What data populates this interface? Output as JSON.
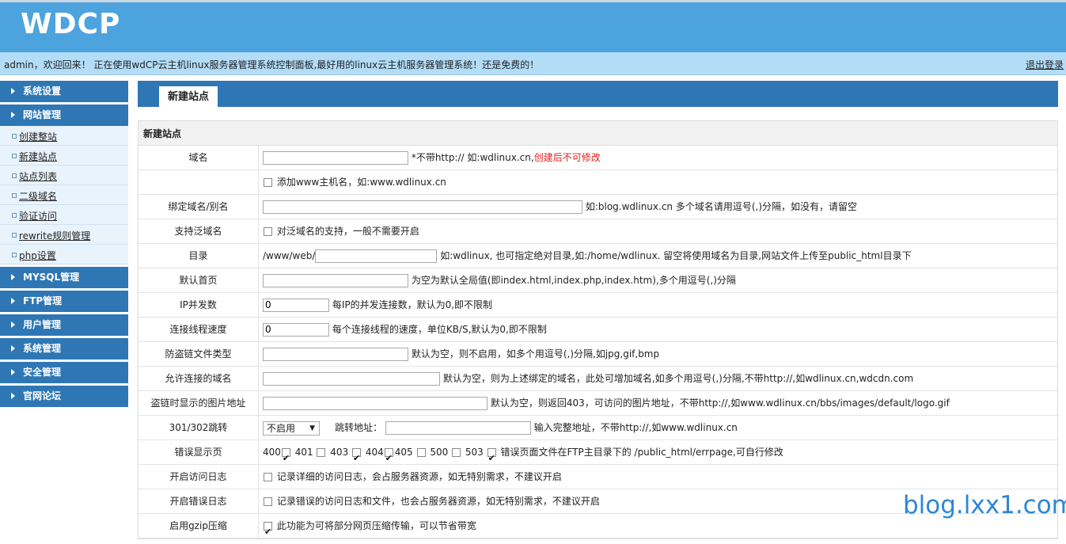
{
  "brand": {
    "logo": "WDCP"
  },
  "welcome": {
    "message": "admin，欢迎回来！ 正在使用wdCP云主机linux服务器管理系统控制面板,最好用的linux云主机服务器管理系统！还是免费的！",
    "logout": "退出登录"
  },
  "sidebar": {
    "sections": [
      {
        "label": "系统设置"
      },
      {
        "label": "网站管理",
        "items": [
          "创建整站",
          "新建站点",
          "站点列表",
          "二级域名",
          "验证访问",
          "rewrite规则管理",
          "php设置"
        ]
      },
      {
        "label": "MYSQL管理"
      },
      {
        "label": "FTP管理"
      },
      {
        "label": "用户管理"
      },
      {
        "label": "系统管理"
      },
      {
        "label": "安全管理"
      },
      {
        "label": "官网论坛"
      }
    ]
  },
  "main": {
    "tab": "新建站点",
    "form_title": "新建站点",
    "rows": {
      "domain": {
        "label": "域名",
        "hint": "*不带http:// 如:wdlinux.cn,",
        "hint_red": "创建后不可修改",
        "value": ""
      },
      "www": {
        "hint": "添加www主机名，如:www.wdlinux.cn"
      },
      "alias": {
        "label": "绑定域名/别名",
        "hint": "如:blog.wdlinux.cn 多个域名请用逗号(,)分隔，如没有，请留空"
      },
      "wildcard": {
        "label": "支持泛域名",
        "hint": "对泛域名的支持，一般不需要开启"
      },
      "dir": {
        "label": "目录",
        "prefix": "/www/web/",
        "hint": "如:wdlinux, 也可指定绝对目录,如:/home/wdlinux. 留空将使用域名为目录,网站文件上传至public_html目录下"
      },
      "index": {
        "label": "默认首页",
        "hint": "为空为默认全局值(即index.html,index.php,index.htm),多个用逗号(,)分隔"
      },
      "ipconn": {
        "label": "IP并发数",
        "value": "0",
        "hint": "每IP的并发连接数，默认为0,即不限制"
      },
      "speed": {
        "label": "连接线程速度",
        "value": "0",
        "hint": "每个连接线程的速度，单位KB/S,默认为0,即不限制"
      },
      "hotlink": {
        "label": "防盗链文件类型",
        "hint": "默认为空，则不启用，如多个用逗号(,)分隔,如jpg,gif,bmp"
      },
      "allowed": {
        "label": "允许连接的域名",
        "hint": "默认为空，则为上述绑定的域名，此处可增加域名,如多个用逗号(,)分隔,不带http://,如wdlinux.cn,wdcdn.com"
      },
      "hotimg": {
        "label": "盗链时显示的图片地址",
        "hint": "默认为空，则返回403，可访问的图片地址，不带http://,如www.wdlinux.cn/bbs/images/default/logo.gif"
      },
      "redirect": {
        "label": "301/302跳转",
        "select": "不启用",
        "target_label": "跳转地址：",
        "hint": "输入完整地址，不带http://,如www.wdlinux.cn"
      },
      "errpage": {
        "label": "错误显示页",
        "codes": [
          {
            "code": "400",
            "checked": true
          },
          {
            "code": "401",
            "checked": false
          },
          {
            "code": "403",
            "checked": true
          },
          {
            "code": "404",
            "checked": true
          },
          {
            "code": "405",
            "checked": false
          },
          {
            "code": "500",
            "checked": false
          },
          {
            "code": "503",
            "checked": true
          }
        ],
        "hint": "错误页面文件在FTP主目录下的 /public_html/errpage,可自行修改"
      },
      "accesslog": {
        "label": "开启访问日志",
        "hint": "记录详细的访问日志，会占服务器资源，如无特别需求，不建议开启"
      },
      "errorlog": {
        "label": "开启错误日志",
        "hint": "记录错误的访问日志和文件，也会占服务器资源，如无特别需求，不建议开启"
      },
      "gzip": {
        "label": "启用gzip压缩",
        "hint": "此功能为可将部分网页压缩传输，可以节省带宽"
      }
    }
  },
  "watermark": "blog.lxx1.com"
}
